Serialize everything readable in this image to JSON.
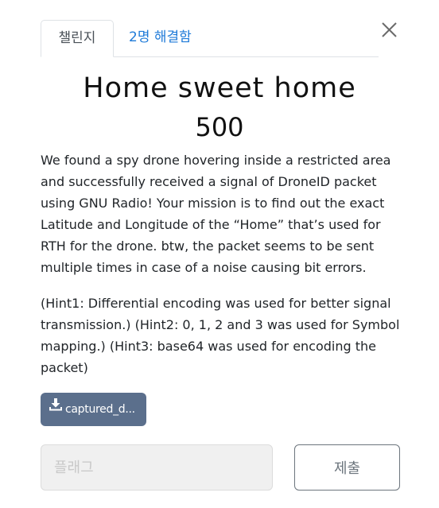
{
  "tabs": {
    "challenge_label": "챌린지",
    "solves_label": "2명 해결함"
  },
  "challenge": {
    "title": "Home sweet home",
    "value": "500",
    "description": "We found a spy drone hovering inside a restricted area and successfully received a signal of DroneID packet using GNU Radio! Your mission is to find out the exact Latitude and Longitude of the “Home” that’s used for RTH for the drone. btw, the packet seems to be sent multiple times in case of a noise causing bit errors.",
    "hints": "(Hint1: Differential encoding was used for better signal transmission.) (Hint2: 0, 1, 2 and 3 was used for Symbol mapping.) (Hint3: base64 was used for encoding the packet)"
  },
  "file": {
    "label": "captured_d...",
    "icon": "download-icon"
  },
  "form": {
    "flag_placeholder": "플래그",
    "flag_value": "",
    "submit_label": "제출"
  },
  "colors": {
    "solves_tab": "#1e7ad8",
    "file_button": "#5b6f8c",
    "submit_border": "#6c757d"
  }
}
